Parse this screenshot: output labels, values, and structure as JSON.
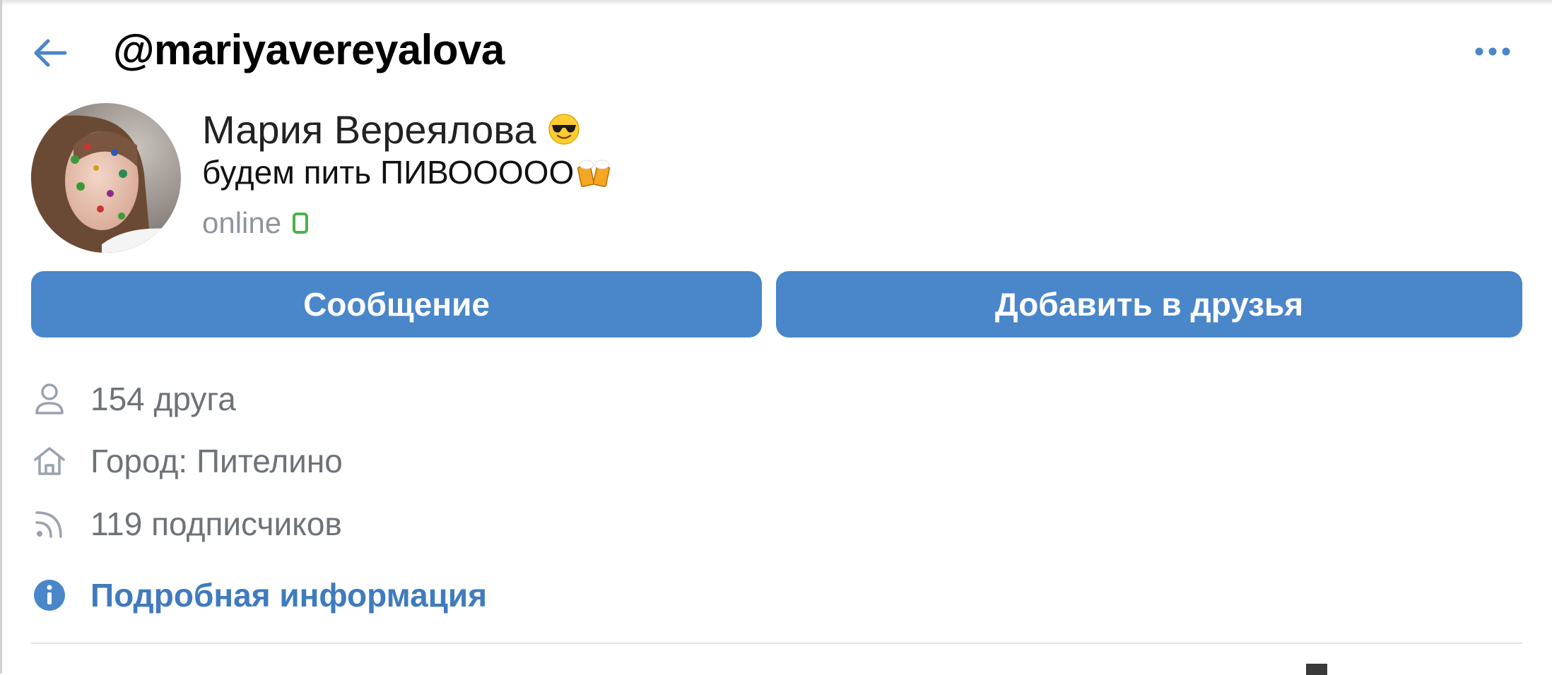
{
  "header": {
    "back_icon": "arrow-left-icon",
    "username": "@mariyavereyalova",
    "more_icon": "more-horizontal-icon"
  },
  "profile": {
    "name": "Мария Вереялова",
    "name_emoji": "sunglasses-emoji-icon",
    "status": "будем пить ПИВОOOOO",
    "status_emoji": "beer-mugs-emoji-icon",
    "online_text": "online",
    "online_device_icon": "mobile-phone-icon"
  },
  "actions": {
    "message_label": "Сообщение",
    "add_friend_label": "Добавить в друзья"
  },
  "info": {
    "friends": "154 друга",
    "friends_icon": "user-icon",
    "city": "Город: Пителино",
    "city_icon": "home-icon",
    "subscribers": "119 подписчиков",
    "subscribers_icon": "rss-feed-icon",
    "details_link": "Подробная информация",
    "details_icon": "info-circle-icon"
  },
  "colors": {
    "accent": "#4a86ca",
    "link": "#3f7bbd",
    "secondary_text": "#6e7378",
    "online_green": "#4bb34b"
  }
}
